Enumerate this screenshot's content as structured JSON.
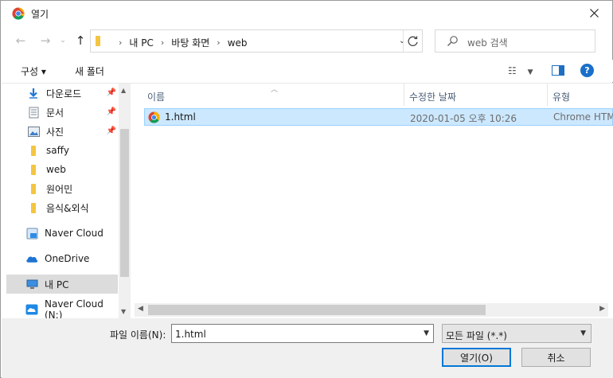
{
  "title": "열기",
  "address": {
    "crumbs": [
      "내 PC",
      "바탕 화면",
      "web"
    ]
  },
  "search": {
    "placeholder": "web 검색"
  },
  "toolbar": {
    "organize": "구성 ▾",
    "new_folder": "새 폴더",
    "help": "?"
  },
  "nav": {
    "items": [
      {
        "label": "다운로드",
        "icon": "download-icon",
        "pinned": true
      },
      {
        "label": "문서",
        "icon": "document-icon",
        "pinned": true
      },
      {
        "label": "사진",
        "icon": "pictures-icon",
        "pinned": true
      },
      {
        "label": "saffy",
        "icon": "folder-icon",
        "pinned": false
      },
      {
        "label": "web",
        "icon": "folder-icon",
        "pinned": false
      },
      {
        "label": "원어민",
        "icon": "folder-icon",
        "pinned": false
      },
      {
        "label": "음식&외식",
        "icon": "folder-icon",
        "pinned": false
      },
      {
        "label": "Naver Cloud",
        "icon": "naver-cloud-icon",
        "pinned": false
      },
      {
        "label": "OneDrive",
        "icon": "onedrive-icon",
        "pinned": false
      },
      {
        "label": "내 PC",
        "icon": "pc-icon",
        "pinned": false,
        "selected": true
      },
      {
        "label": "Naver Cloud (N:)",
        "icon": "naver-cloud-drive-icon",
        "pinned": false
      }
    ]
  },
  "columns": {
    "name": "이름",
    "modified": "수정한 날짜",
    "type": "유형"
  },
  "files": [
    {
      "name": "1.html",
      "modified": "2020-01-05 오후 10:26",
      "type": "Chrome HTML Document",
      "icon": "chrome-icon",
      "selected": true
    }
  ],
  "bottom": {
    "filename_label": "파일 이름(N):",
    "filename_value": "1.html",
    "filter_value": "모든 파일 (*.*)",
    "open_label": "열기(O)",
    "cancel_label": "취소"
  }
}
